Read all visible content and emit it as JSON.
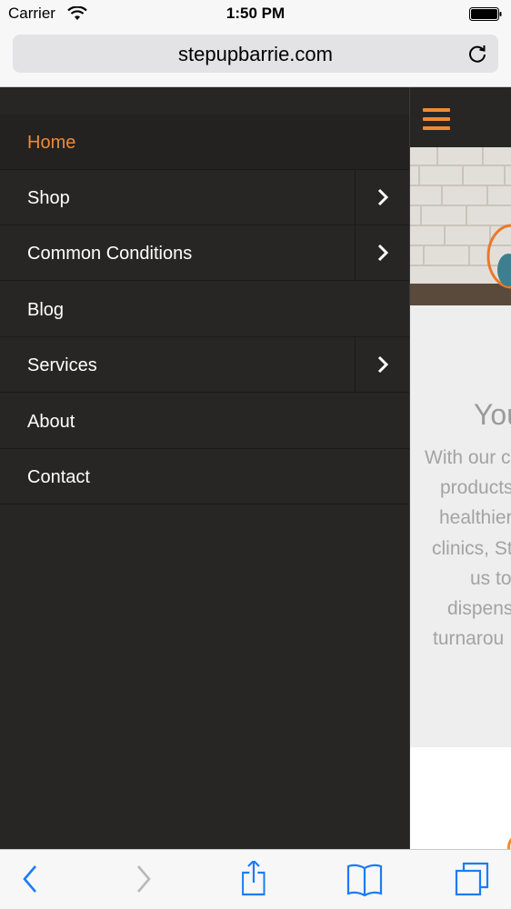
{
  "status_bar": {
    "carrier": "Carrier",
    "time": "1:50 PM"
  },
  "browser": {
    "url": "stepupbarrie.com"
  },
  "nav": {
    "items": [
      {
        "label": "Home",
        "active": true,
        "has_submenu": false
      },
      {
        "label": "Shop",
        "active": false,
        "has_submenu": true
      },
      {
        "label": "Common Conditions",
        "active": false,
        "has_submenu": true
      },
      {
        "label": "Blog",
        "active": false,
        "has_submenu": false
      },
      {
        "label": "Services",
        "active": false,
        "has_submenu": true
      },
      {
        "label": "About",
        "active": false,
        "has_submenu": false
      },
      {
        "label": "Contact",
        "active": false,
        "has_submenu": false
      }
    ]
  },
  "content": {
    "headline": "You",
    "paragraph_lines": [
      "With our c",
      "products",
      "healthier",
      "clinics, St",
      "us to",
      "dispens",
      "turnarou"
    ]
  },
  "toolbar": {
    "back_icon": "chevron-left-icon",
    "forward_icon": "chevron-right-icon",
    "share_icon": "share-icon",
    "bookmarks_icon": "book-icon",
    "tabs_icon": "tabs-icon"
  },
  "colors": {
    "accent": "#ef8a35",
    "nav_bg": "#272625",
    "ios_blue": "#1a7cf5"
  }
}
